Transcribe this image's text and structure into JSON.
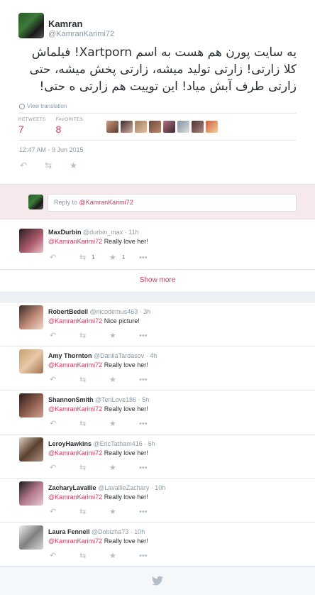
{
  "tweet": {
    "author_name": "Kamran",
    "author_handle": "@KamranKarimi72",
    "text": "یه سایت پورن هم هست به اسم Xartporn! فیلماش کلا زارتی! زارتی تولید میشه، زارتی پخش میشه، حتی زارتی طرف آبش میاد! این توییت هم زارتی ه حتی!",
    "translate_label": "View translation",
    "retweets_label": "RETWEETS",
    "retweets_count": "7",
    "favorites_label": "FAVORITES",
    "favorites_count": "8",
    "timestamp": "12:47 AM - 9 Jun 2015"
  },
  "reply_box": {
    "prefix": "Reply to ",
    "mention": "@KamranKarimi72"
  },
  "show_more": "Show more",
  "colors": {
    "accent": "#cc3a5c",
    "muted": "#8899a6",
    "reply_box_bg": "#f5e9ec"
  },
  "replies": [
    {
      "name": "MaxDurbin",
      "handle": "@durbin_max",
      "time": "11h",
      "mention": "@KamranKarimi72",
      "text": "Really love her!",
      "retweets": "1",
      "favorites": "1"
    },
    {
      "name": "RobertBedell",
      "handle": "@nicodemus463",
      "time": "3h",
      "mention": "@KamranKarimi72",
      "text": "Nice picture!"
    },
    {
      "name": "Amy Thornton",
      "handle": "@DanilaTardasov",
      "time": "4h",
      "mention": "@KamranKarimi72",
      "text": "Really love her!"
    },
    {
      "name": "ShannonSmith",
      "handle": "@TeriLove186",
      "time": "5h",
      "mention": "@KamranKarimi72",
      "text": "Really love her!"
    },
    {
      "name": "LeroyHawkins",
      "handle": "@EricTatham416",
      "time": "6h",
      "mention": "@KamranKarimi72",
      "text": "Really love her!"
    },
    {
      "name": "ZacharyLavallie",
      "handle": "@LavallieZachary",
      "time": "10h",
      "mention": "@KamranKarimi72",
      "text": "Really love her!"
    },
    {
      "name": "Laura Fennell",
      "handle": "@Dobizha73",
      "time": "10h",
      "mention": "@KamranKarimi72",
      "text": "Really love her!"
    }
  ],
  "icons": {
    "reply": "reply-icon",
    "retweet": "retweet-icon",
    "favorite": "star-icon",
    "more": "more-icon",
    "globe": "globe-icon",
    "bird": "twitter-bird-icon"
  }
}
